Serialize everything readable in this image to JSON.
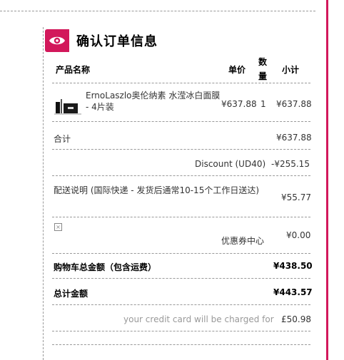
{
  "header": {
    "title": "确认订单信息",
    "icon": "eye-icon",
    "accent": "#d2185b"
  },
  "columns": {
    "product": "产品名称",
    "unit_price": "单价",
    "qty_line1": "数",
    "qty_line2": "量",
    "subtotal": "小计"
  },
  "item": {
    "name": "ErnoLaszlo奥伦纳素 水滢冰白面膜 - 4片装",
    "unit_price": "¥637.88",
    "qty": "1",
    "subtotal": "¥637.88"
  },
  "summary": {
    "total_label": "合计",
    "total_value": "¥637.88",
    "discount_label": "Discount (UD40)",
    "discount_value": "-¥255.15",
    "shipping_label": "配送说明 (国际快递 - 发货后通常10-15个工作日送达)",
    "shipping_value": "¥55.77",
    "coupon_label": "优惠券中心",
    "coupon_value": "¥0.00",
    "cart_total_label": "购物车总金额（包含运费）",
    "cart_total_value": "¥438.50",
    "grand_total_label": "总计金额",
    "grand_total_value": "¥443.57",
    "charged_label": "your credit card will be charged for",
    "charged_value": "£50.98"
  }
}
